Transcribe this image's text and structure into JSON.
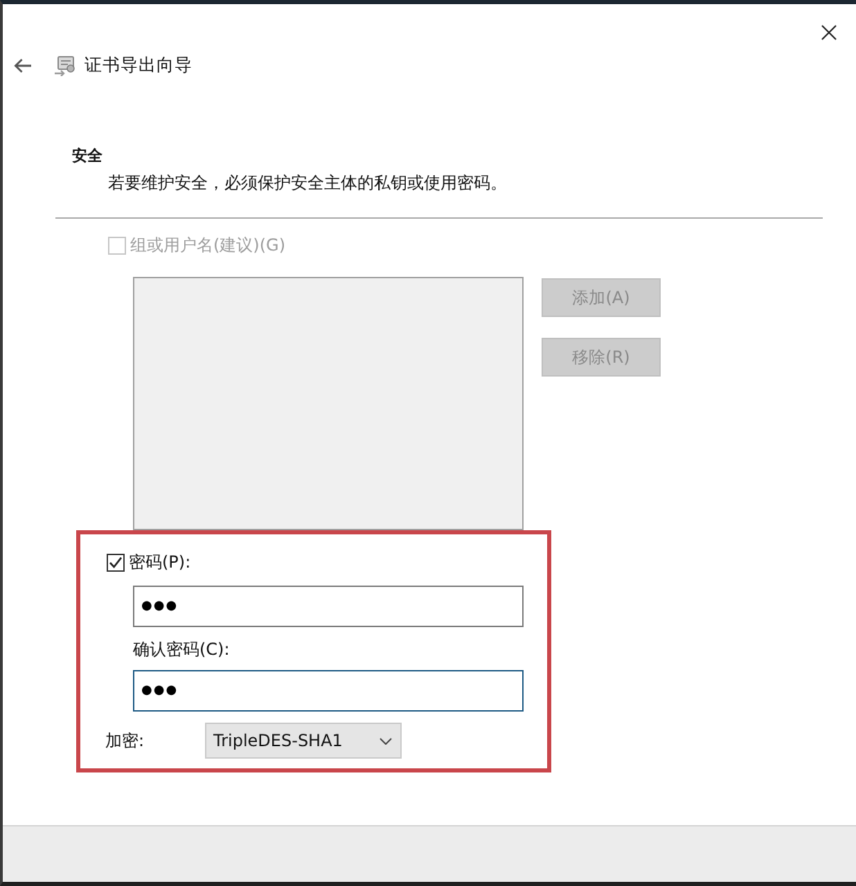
{
  "window": {
    "title": "证书导出向导"
  },
  "header": {
    "heading": "安全",
    "description": "若要维护安全，必须保护安全主体的私钥或使用密码。"
  },
  "group_option": {
    "label": "组或用户名(建议)(G)",
    "checked": false,
    "disabled": true
  },
  "principal_list": {
    "disabled": true
  },
  "list_buttons": [
    {
      "label": "添加(A)",
      "disabled": true
    },
    {
      "label": "移除(R)",
      "disabled": true
    }
  ],
  "password_section": {
    "highlighted": true,
    "password_option": {
      "label": "密码(P):",
      "checked": true,
      "disabled": false
    },
    "password_field": {
      "value": "●●●",
      "focused": false
    },
    "confirm_label": "确认密码(C):",
    "confirm_field": {
      "value": "●●●",
      "focused": true
    },
    "encryption": {
      "label": "加密:",
      "value": "TripleDES-SHA1"
    }
  }
}
